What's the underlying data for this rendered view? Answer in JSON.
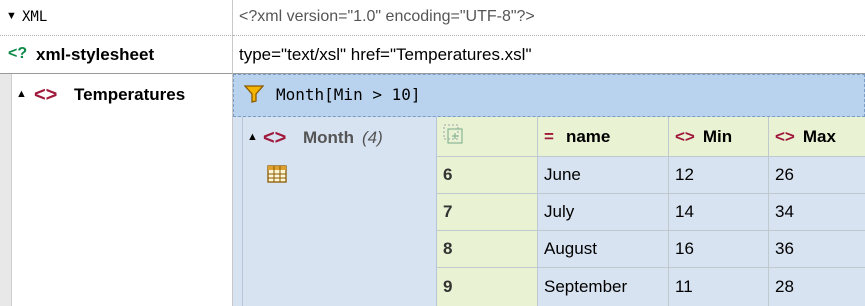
{
  "xml_row": {
    "label": "XML",
    "declaration": "<?xml version=\"1.0\" encoding=\"UTF-8\"?>"
  },
  "stylesheet_row": {
    "icon": "<?",
    "label": "xml-stylesheet",
    "value": "type=\"text/xsl\" href=\"Temperatures.xsl\""
  },
  "temperatures": {
    "icon": "<>",
    "label": "Temperatures"
  },
  "filter": {
    "expression": "Month[Min > 10]"
  },
  "month": {
    "icon": "<>",
    "label": "Month",
    "count": "(4)"
  },
  "table": {
    "headers": [
      {
        "icon": "=",
        "label": "name"
      },
      {
        "icon": "<>",
        "label": "Min"
      },
      {
        "icon": "<>",
        "label": "Max"
      }
    ],
    "rows": [
      {
        "index": "6",
        "name": "June",
        "min": "12",
        "max": "26"
      },
      {
        "index": "7",
        "name": "July",
        "min": "14",
        "max": "34"
      },
      {
        "index": "8",
        "name": "August",
        "min": "16",
        "max": "36"
      },
      {
        "index": "9",
        "name": "September",
        "min": "11",
        "max": "28"
      }
    ]
  },
  "colors": {
    "tag_icon": "#a0193c",
    "pi_icon": "#0b8a4a",
    "filter_bar": "#b9d3ef",
    "header_cell": "#e9f3d3",
    "block_bg": "#d8e3f1"
  }
}
